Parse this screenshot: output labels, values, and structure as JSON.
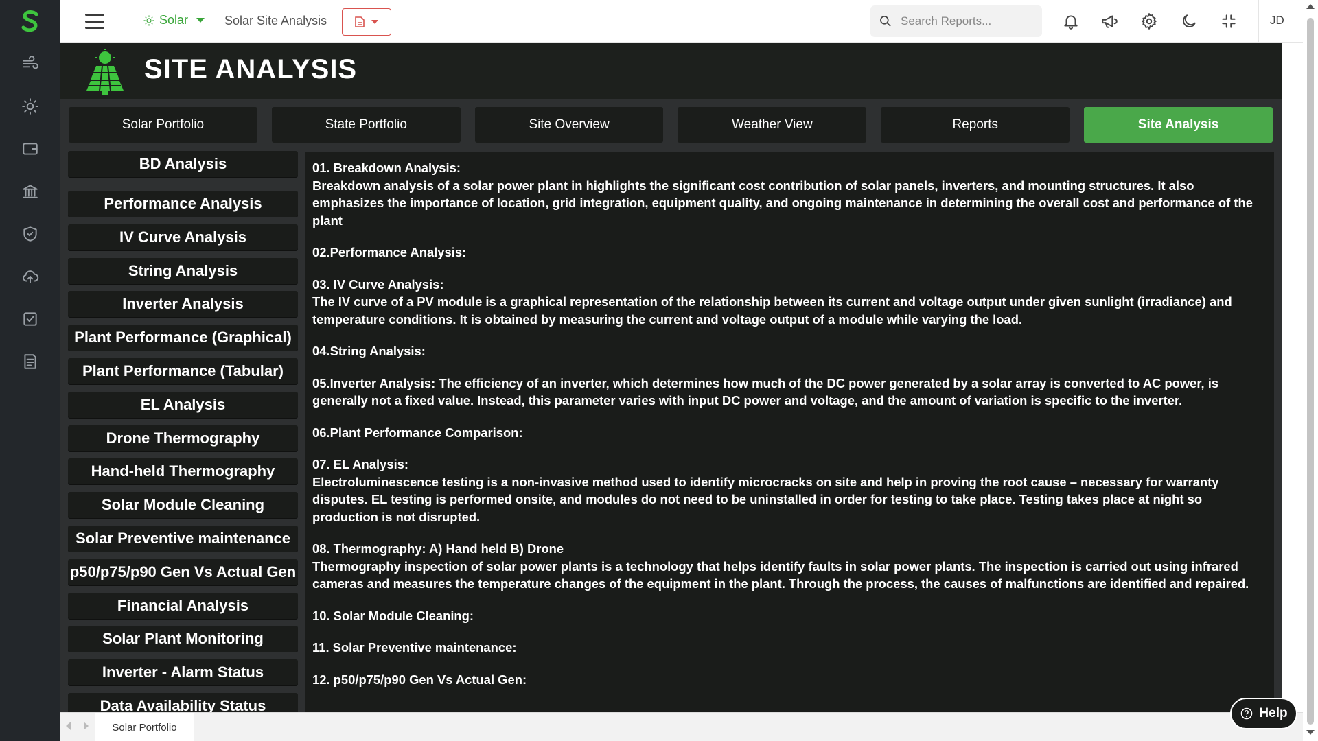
{
  "topbar": {
    "sector_label": "Solar",
    "site_title": "Solar Site Analysis",
    "search_placeholder": "Search Reports...",
    "user_initials": "JD"
  },
  "rail": {
    "icons": [
      "logo-icon",
      "wind-icon",
      "sun-icon",
      "wallet-icon",
      "bank-icon",
      "shield-check-icon",
      "cloud-upload-icon",
      "checkbox-icon",
      "report-icon"
    ]
  },
  "header": {
    "title": "SITE ANALYSIS"
  },
  "tabs": [
    {
      "label": "Solar Portfolio",
      "active": false
    },
    {
      "label": "State Portfolio",
      "active": false
    },
    {
      "label": "Site Overview",
      "active": false
    },
    {
      "label": "Weather View",
      "active": false
    },
    {
      "label": "Reports",
      "active": false
    },
    {
      "label": "Site Analysis",
      "active": true
    }
  ],
  "sidebar": {
    "items": [
      "BD Analysis",
      "Performance Analysis",
      "IV Curve Analysis",
      "String Analysis",
      "Inverter Analysis",
      "Plant Performance (Graphical)",
      "Plant Performance (Tabular)",
      "EL Analysis",
      "Drone Thermography",
      "Hand-held Thermography",
      "Solar Module Cleaning",
      "Solar Preventive maintenance",
      "p50/p75/p90 Gen Vs Actual Gen",
      "Financial Analysis",
      "Solar Plant Monitoring",
      "Inverter - Alarm Status",
      "Data Availability Status"
    ]
  },
  "content": {
    "sections": [
      {
        "heading": "01. Breakdown Analysis:",
        "body": "Breakdown analysis of a solar power plant in highlights the significant cost contribution of solar panels, inverters, and mounting structures. It also emphasizes the importance of location, grid integration, equipment quality, and ongoing maintenance in determining the overall cost and performance of the plant"
      },
      {
        "heading": "02.Performance Analysis:",
        "body": ""
      },
      {
        "heading": "03. IV Curve Analysis:",
        "body": "The IV curve of a PV module is a graphical representation of the relationship between its current and voltage output under given sunlight (irradiance) and temperature conditions. It is obtained by measuring the current and voltage output of a module while varying the load."
      },
      {
        "heading": "04.String Analysis:",
        "body": ""
      },
      {
        "heading": "05.Inverter Analysis: The efficiency of an inverter, which determines how much of the DC power generated by a solar array is converted to AC power, is generally not a fixed value. Instead, this parameter varies with input DC power and voltage, and the amount of variation is specific to the inverter.",
        "body": ""
      },
      {
        "heading": "06.Plant Performance Comparison:",
        "body": ""
      },
      {
        "heading": "07. EL Analysis:",
        "body": "Electroluminescence testing is a non-invasive method used to identify microcracks on site and help in proving the root cause – necessary for warranty disputes. EL testing is performed onsite, and modules do not need to be uninstalled in order for testing to take place. Testing takes place at night so production is not disrupted."
      },
      {
        "heading": "08. Thermography: A) Hand held B) Drone",
        "body": "Thermography inspection of solar power plants is a technology that helps identify faults in solar power plants. The inspection is carried out using infrared cameras and measures the temperature changes of the equipment in the plant. Through the process, the causes of malfunctions are identified and repaired."
      },
      {
        "heading": "10. Solar Module Cleaning:",
        "body": ""
      },
      {
        "heading": "11. Solar Preventive maintenance:",
        "body": ""
      },
      {
        "heading": "12. p50/p75/p90 Gen Vs Actual Gen:",
        "body": ""
      }
    ]
  },
  "bottom": {
    "sheet_tab": "Solar Portfolio"
  },
  "help": {
    "label": "Help"
  },
  "colors": {
    "accent_green": "#4aa84a",
    "rail_bg": "#23272b",
    "panel_bg": "#1a1c1a",
    "doc_button_red": "#d9534f"
  }
}
